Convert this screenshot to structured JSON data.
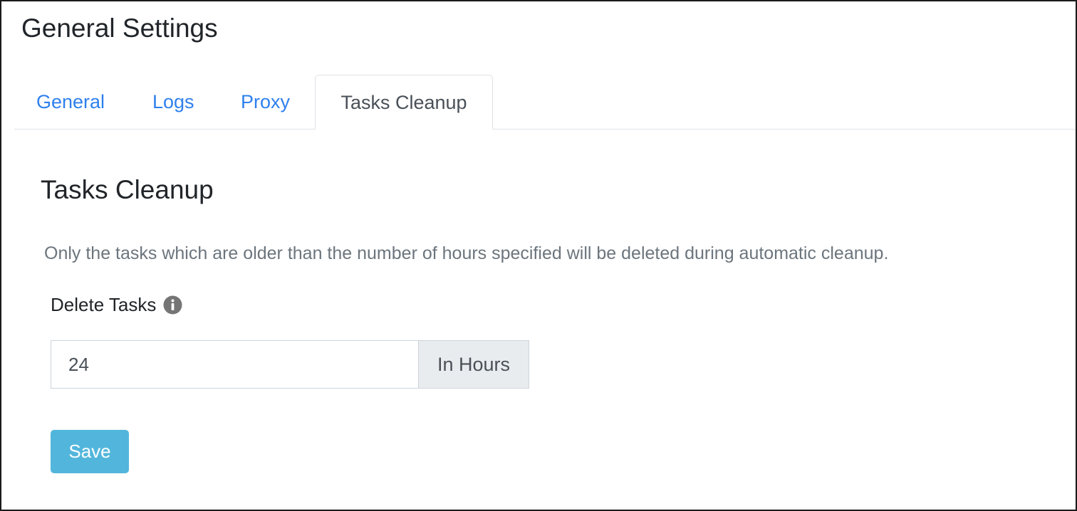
{
  "page": {
    "title": "General Settings"
  },
  "tabs": [
    {
      "label": "General",
      "active": false
    },
    {
      "label": "Logs",
      "active": false
    },
    {
      "label": "Proxy",
      "active": false
    },
    {
      "label": "Tasks Cleanup",
      "active": true
    }
  ],
  "section": {
    "title": "Tasks Cleanup",
    "description": "Only the tasks which are older than the number of hours specified will be deleted during automatic cleanup."
  },
  "delete_tasks": {
    "label": "Delete Tasks",
    "info_icon": "info-circle-icon",
    "value": "24",
    "unit_addon": "In Hours"
  },
  "actions": {
    "save_label": "Save"
  },
  "colors": {
    "link_blue": "#2f80ed",
    "save_button": "#52b6dc",
    "addon_bg": "#e9ecef",
    "muted_text": "#6c757d"
  }
}
